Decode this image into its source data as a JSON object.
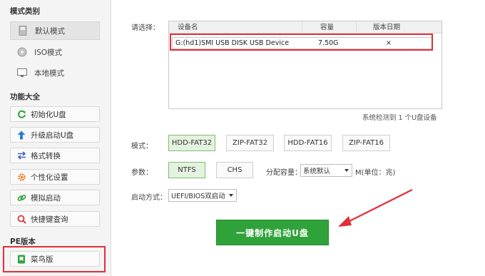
{
  "sidebar": {
    "mode_title": "模式类别",
    "modes": [
      {
        "label": "默认模式",
        "icon": "usb-drive-icon",
        "active": true
      },
      {
        "label": "ISO模式",
        "icon": "disc-icon",
        "active": false
      },
      {
        "label": "本地模式",
        "icon": "monitor-icon",
        "active": false
      }
    ],
    "function_title": "功能大全",
    "functions": [
      {
        "label": "初始化U盘",
        "icon": "refresh-icon"
      },
      {
        "label": "升级启动U盘",
        "icon": "upload-arrow-icon"
      },
      {
        "label": "格式转换",
        "icon": "swap-arrows-icon"
      },
      {
        "label": "个性化设置",
        "icon": "gear-icon"
      },
      {
        "label": "模拟启动",
        "icon": "link-icon"
      },
      {
        "label": "快捷键查询",
        "icon": "search-icon"
      }
    ],
    "pe_title": "PE版本",
    "pe_items": [
      {
        "label": "菜鸟版",
        "icon": "bookmark-icon"
      }
    ]
  },
  "main": {
    "select_label": "请选择：",
    "device_table": {
      "headers": [
        "设备名",
        "容量",
        "版本日期"
      ],
      "rows": [
        {
          "name": "G:(hd1)SMI USB DISK USB Device",
          "capacity": "7.50G",
          "date": "×"
        }
      ]
    },
    "status_text": "系统检测到 1 个U盘设备",
    "mode_label": "模式：",
    "mode_options": [
      "HDD-FAT32",
      "ZIP-FAT32",
      "HDD-FAT16",
      "ZIP-FAT16"
    ],
    "mode_selected": "HDD-FAT32",
    "param_label": "参数：",
    "param_options": [
      "NTFS",
      "CHS"
    ],
    "param_selected": "NTFS",
    "alloc_label": "分配容量：",
    "alloc_value": "系统默认",
    "alloc_unit": "M(单位：兆)",
    "boot_label": "启动方式：",
    "boot_value": "UEFI/BIOS双启动",
    "action_button": "一键制作启动U盘"
  },
  "colors": {
    "accent_green": "#2fa33a",
    "highlight_red": "#e0303a"
  }
}
